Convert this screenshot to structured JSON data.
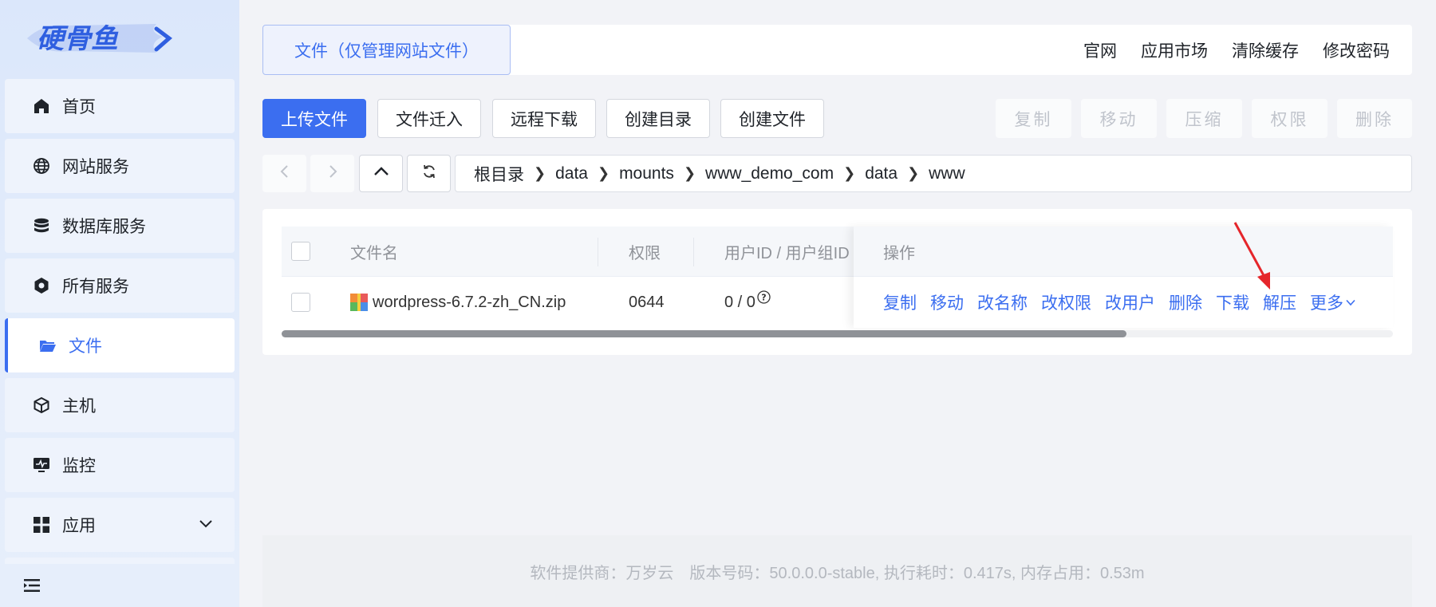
{
  "brand": {
    "name": "硬骨鱼",
    "color": "#3b6ef0"
  },
  "sidebar": {
    "items": [
      {
        "label": "首页",
        "icon": "home-icon"
      },
      {
        "label": "网站服务",
        "icon": "globe-icon"
      },
      {
        "label": "数据库服务",
        "icon": "database-icon"
      },
      {
        "label": "所有服务",
        "icon": "services-icon"
      },
      {
        "label": "文件",
        "icon": "folder-open-icon",
        "active": true
      },
      {
        "label": "主机",
        "icon": "host-icon"
      },
      {
        "label": "监控",
        "icon": "monitor-icon"
      },
      {
        "label": "应用",
        "icon": "apps-grid-icon",
        "expandable": true
      }
    ],
    "collapse_icon": "menu-collapse-icon"
  },
  "header": {
    "tab": "文件（仅管理网站文件）",
    "links": [
      "官网",
      "应用市场",
      "清除缓存",
      "修改密码"
    ]
  },
  "toolbar": {
    "upload": "上传文件",
    "import": "文件迁入",
    "remote_download": "远程下载",
    "create_dir": "创建目录",
    "create_file": "创建文件",
    "copy": "复制",
    "move": "移动",
    "compress": "压缩",
    "permission": "权限",
    "delete": "删除"
  },
  "breadcrumb": [
    "根目录",
    "data",
    "mounts",
    "www_demo_com",
    "data",
    "www"
  ],
  "table": {
    "headers": {
      "name": "文件名",
      "perm": "权限",
      "owner": "用户ID / 用户组ID",
      "ops": "操作"
    },
    "rows": [
      {
        "name": "wordpress-6.7.2-zh_CN.zip",
        "perm": "0644",
        "owner": "0 / 0",
        "ops": [
          "复制",
          "移动",
          "改名称",
          "改权限",
          "改用户",
          "删除",
          "下载",
          "解压",
          "更多"
        ]
      }
    ],
    "scroll_fraction": 0.76
  },
  "footer": "软件提供商：万岁云　版本号码：50.0.0.0-stable, 执行耗时：0.417s, 内存占用：0.53m",
  "annotation_color": "#e5262b"
}
